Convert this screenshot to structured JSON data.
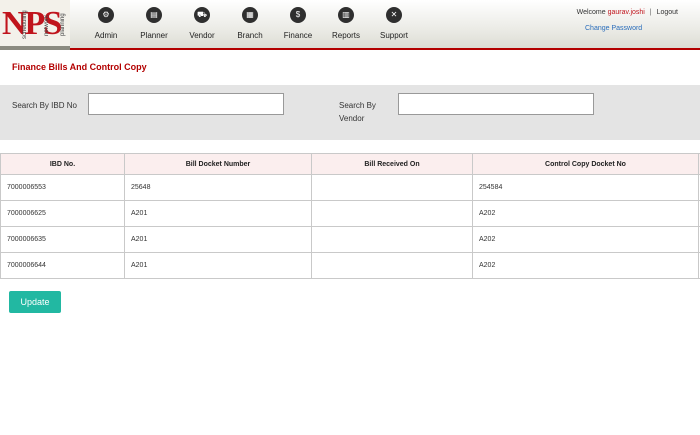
{
  "logo": {
    "brand": "NPS",
    "tag1": "scheduling",
    "tag2": "network",
    "tag3": "planning"
  },
  "nav": [
    {
      "label": "Admin",
      "icon": "⚙",
      "icon_name": "admin-icon"
    },
    {
      "label": "Planner",
      "icon": "▤",
      "icon_name": "planner-icon"
    },
    {
      "label": "Vendor",
      "icon": "⛟",
      "icon_name": "truck-icon"
    },
    {
      "label": "Branch",
      "icon": "▦",
      "icon_name": "branch-icon"
    },
    {
      "label": "Finance",
      "icon": "$",
      "icon_name": "dollar-icon"
    },
    {
      "label": "Reports",
      "icon": "▥",
      "icon_name": "bar-chart-icon"
    },
    {
      "label": "Support",
      "icon": "✕",
      "icon_name": "tools-icon"
    }
  ],
  "header": {
    "welcome": "Welcome",
    "username": "gaurav.joshi",
    "separator": "|",
    "logout": "Logout",
    "change_password": "Change Password"
  },
  "page": {
    "title": "Finance Bills And Control Copy"
  },
  "search": {
    "ibd_label": "Search By IBD No",
    "ibd_value": "",
    "vendor_label": "Search By Vendor",
    "vendor_value": ""
  },
  "table": {
    "headers": [
      "IBD No.",
      "Bill Docket Number",
      "Bill Received On",
      "Control Copy Docket No",
      ""
    ],
    "rows": [
      [
        "7000006553",
        "25648",
        "",
        "254584"
      ],
      [
        "7000006625",
        "A201",
        "",
        "A202"
      ],
      [
        "7000006635",
        "A201",
        "",
        "A202"
      ],
      [
        "7000006644",
        "A201",
        "",
        "A202"
      ]
    ]
  },
  "actions": {
    "update_label": "Update"
  },
  "colors": {
    "accent": "#b30000",
    "button": "#22b8a2",
    "link": "#2a6dbb"
  }
}
